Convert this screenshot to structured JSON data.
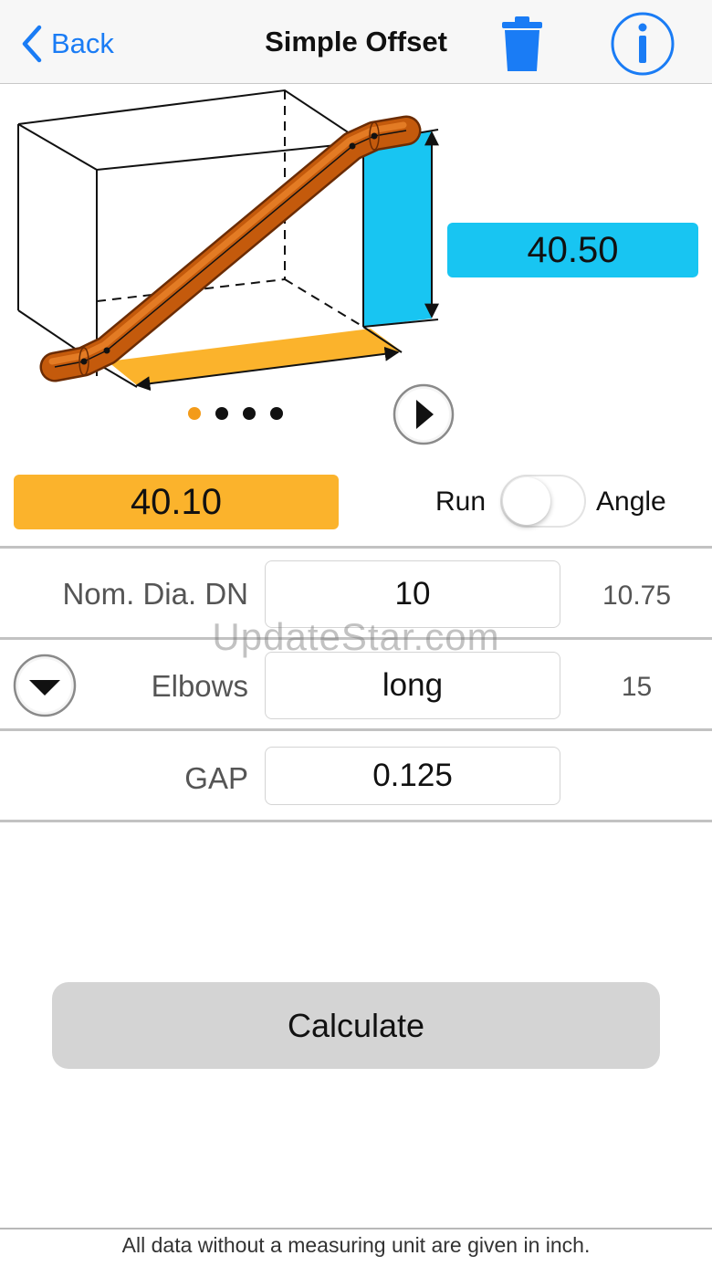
{
  "navbar": {
    "back_label": "Back",
    "title": "Simple Offset",
    "trash_icon": "trash-icon",
    "info_icon": "info-icon"
  },
  "diagram": {
    "height_value": "40.50",
    "page_count": 4,
    "current_page": 1,
    "next_icon": "play-right-icon"
  },
  "run": {
    "value": "40.10",
    "toggle_left_label": "Run",
    "toggle_right_label": "Angle",
    "toggle_on": false
  },
  "rows": {
    "diameter": {
      "label": "Nom. Dia. DN",
      "value": "10",
      "extra": "10.75"
    },
    "elbows": {
      "label": "Elbows",
      "value": "long",
      "extra": "15"
    },
    "gap": {
      "label": "GAP",
      "value": "0.125"
    }
  },
  "watermark": "UpdateStar.com",
  "calculate_label": "Calculate",
  "footer_note": "All data without a measuring unit are given in inch.",
  "colors": {
    "accent_blue": "#1a7cf5",
    "height_cyan": "#18c5f2",
    "run_orange": "#fbb32c",
    "pipe_copper": "#c45a0c",
    "page_dot_active": "#f39b19"
  }
}
